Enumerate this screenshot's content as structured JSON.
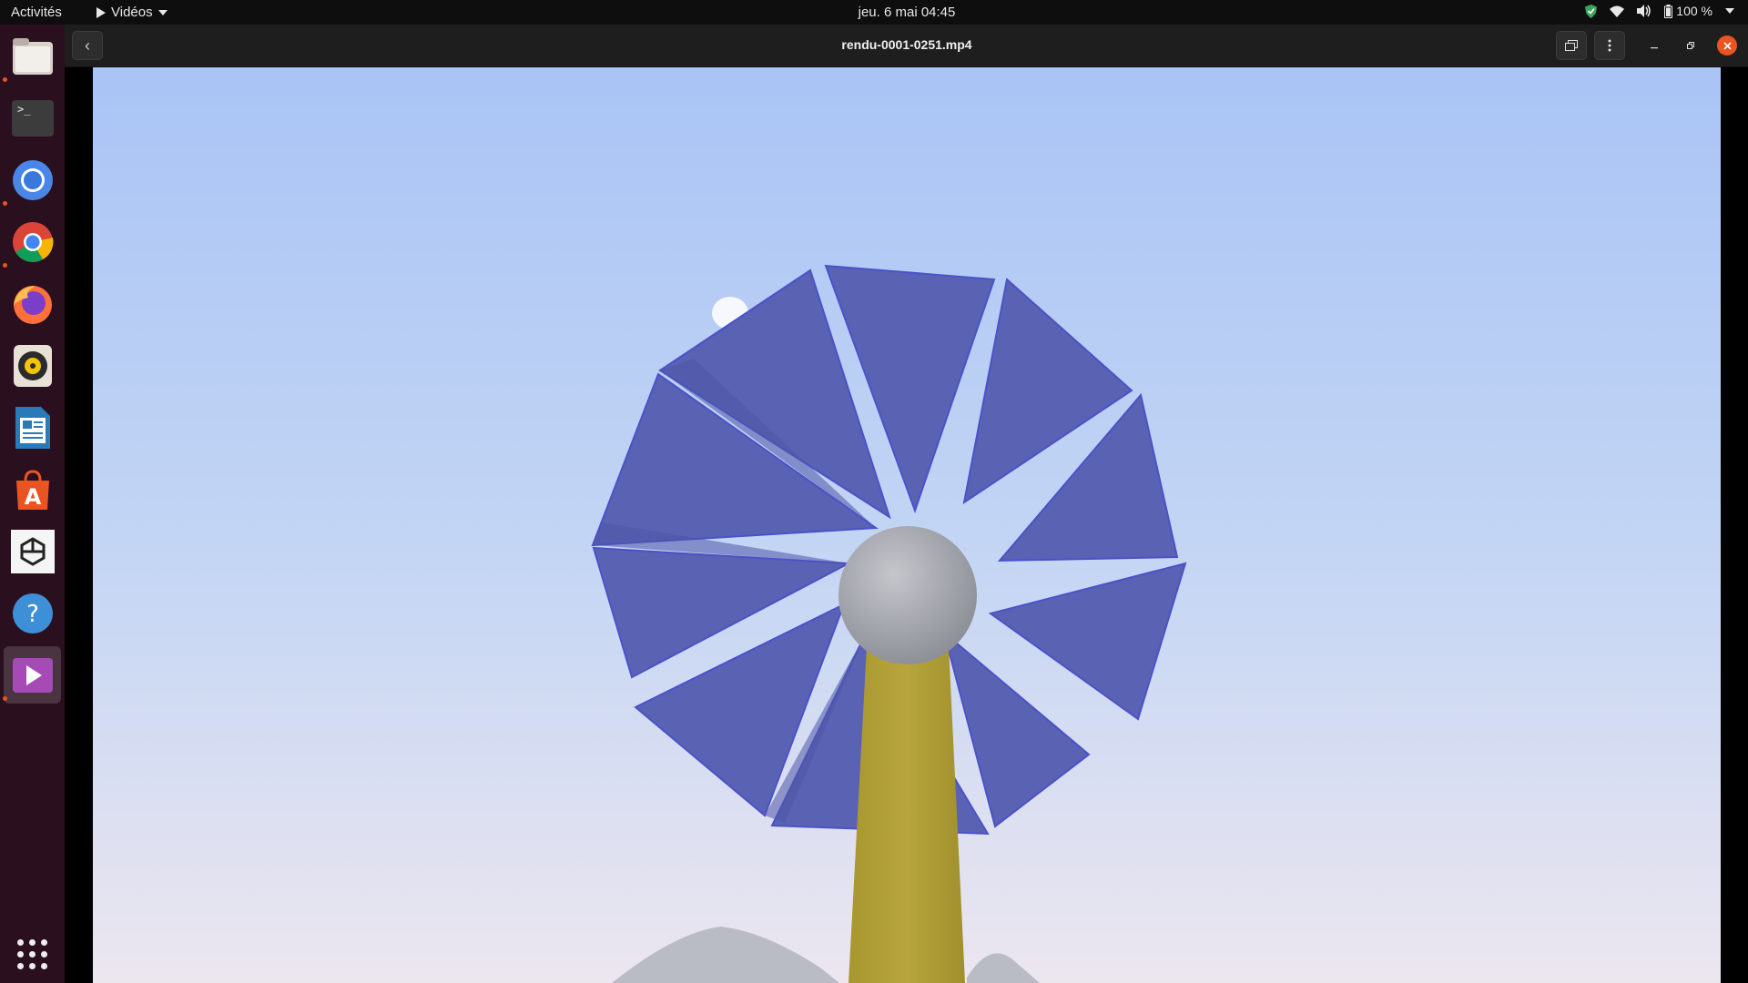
{
  "topbar": {
    "activities": "Activités",
    "app_menu": "Vidéos",
    "clock": "jeu. 6 mai  04:45",
    "battery": "100 %"
  },
  "dock": {
    "items": [
      {
        "name": "files",
        "icon": "folder-icon",
        "running": true
      },
      {
        "name": "terminal",
        "icon": "terminal-icon",
        "running": false
      },
      {
        "name": "chromium",
        "icon": "chromium-icon",
        "running": true
      },
      {
        "name": "chrome",
        "icon": "chrome-icon",
        "running": true
      },
      {
        "name": "firefox",
        "icon": "firefox-icon",
        "running": false
      },
      {
        "name": "rhythmbox",
        "icon": "rhythmbox-icon",
        "running": false
      },
      {
        "name": "writer",
        "icon": "document-icon",
        "running": false
      },
      {
        "name": "software",
        "icon": "store-icon",
        "running": false
      },
      {
        "name": "unity",
        "icon": "unity-icon",
        "running": false
      },
      {
        "name": "help",
        "icon": "help-icon",
        "running": false
      },
      {
        "name": "videos",
        "icon": "videos-icon",
        "running": true,
        "active": true
      }
    ]
  },
  "window": {
    "title": "rendu-0001-0251.mp4"
  },
  "colors": {
    "accent": "#e95420",
    "sky_top": "#a9c4f5",
    "sky_bottom": "#ece6ef",
    "blade": "#5a63b5",
    "pole": "#b3a23a"
  }
}
